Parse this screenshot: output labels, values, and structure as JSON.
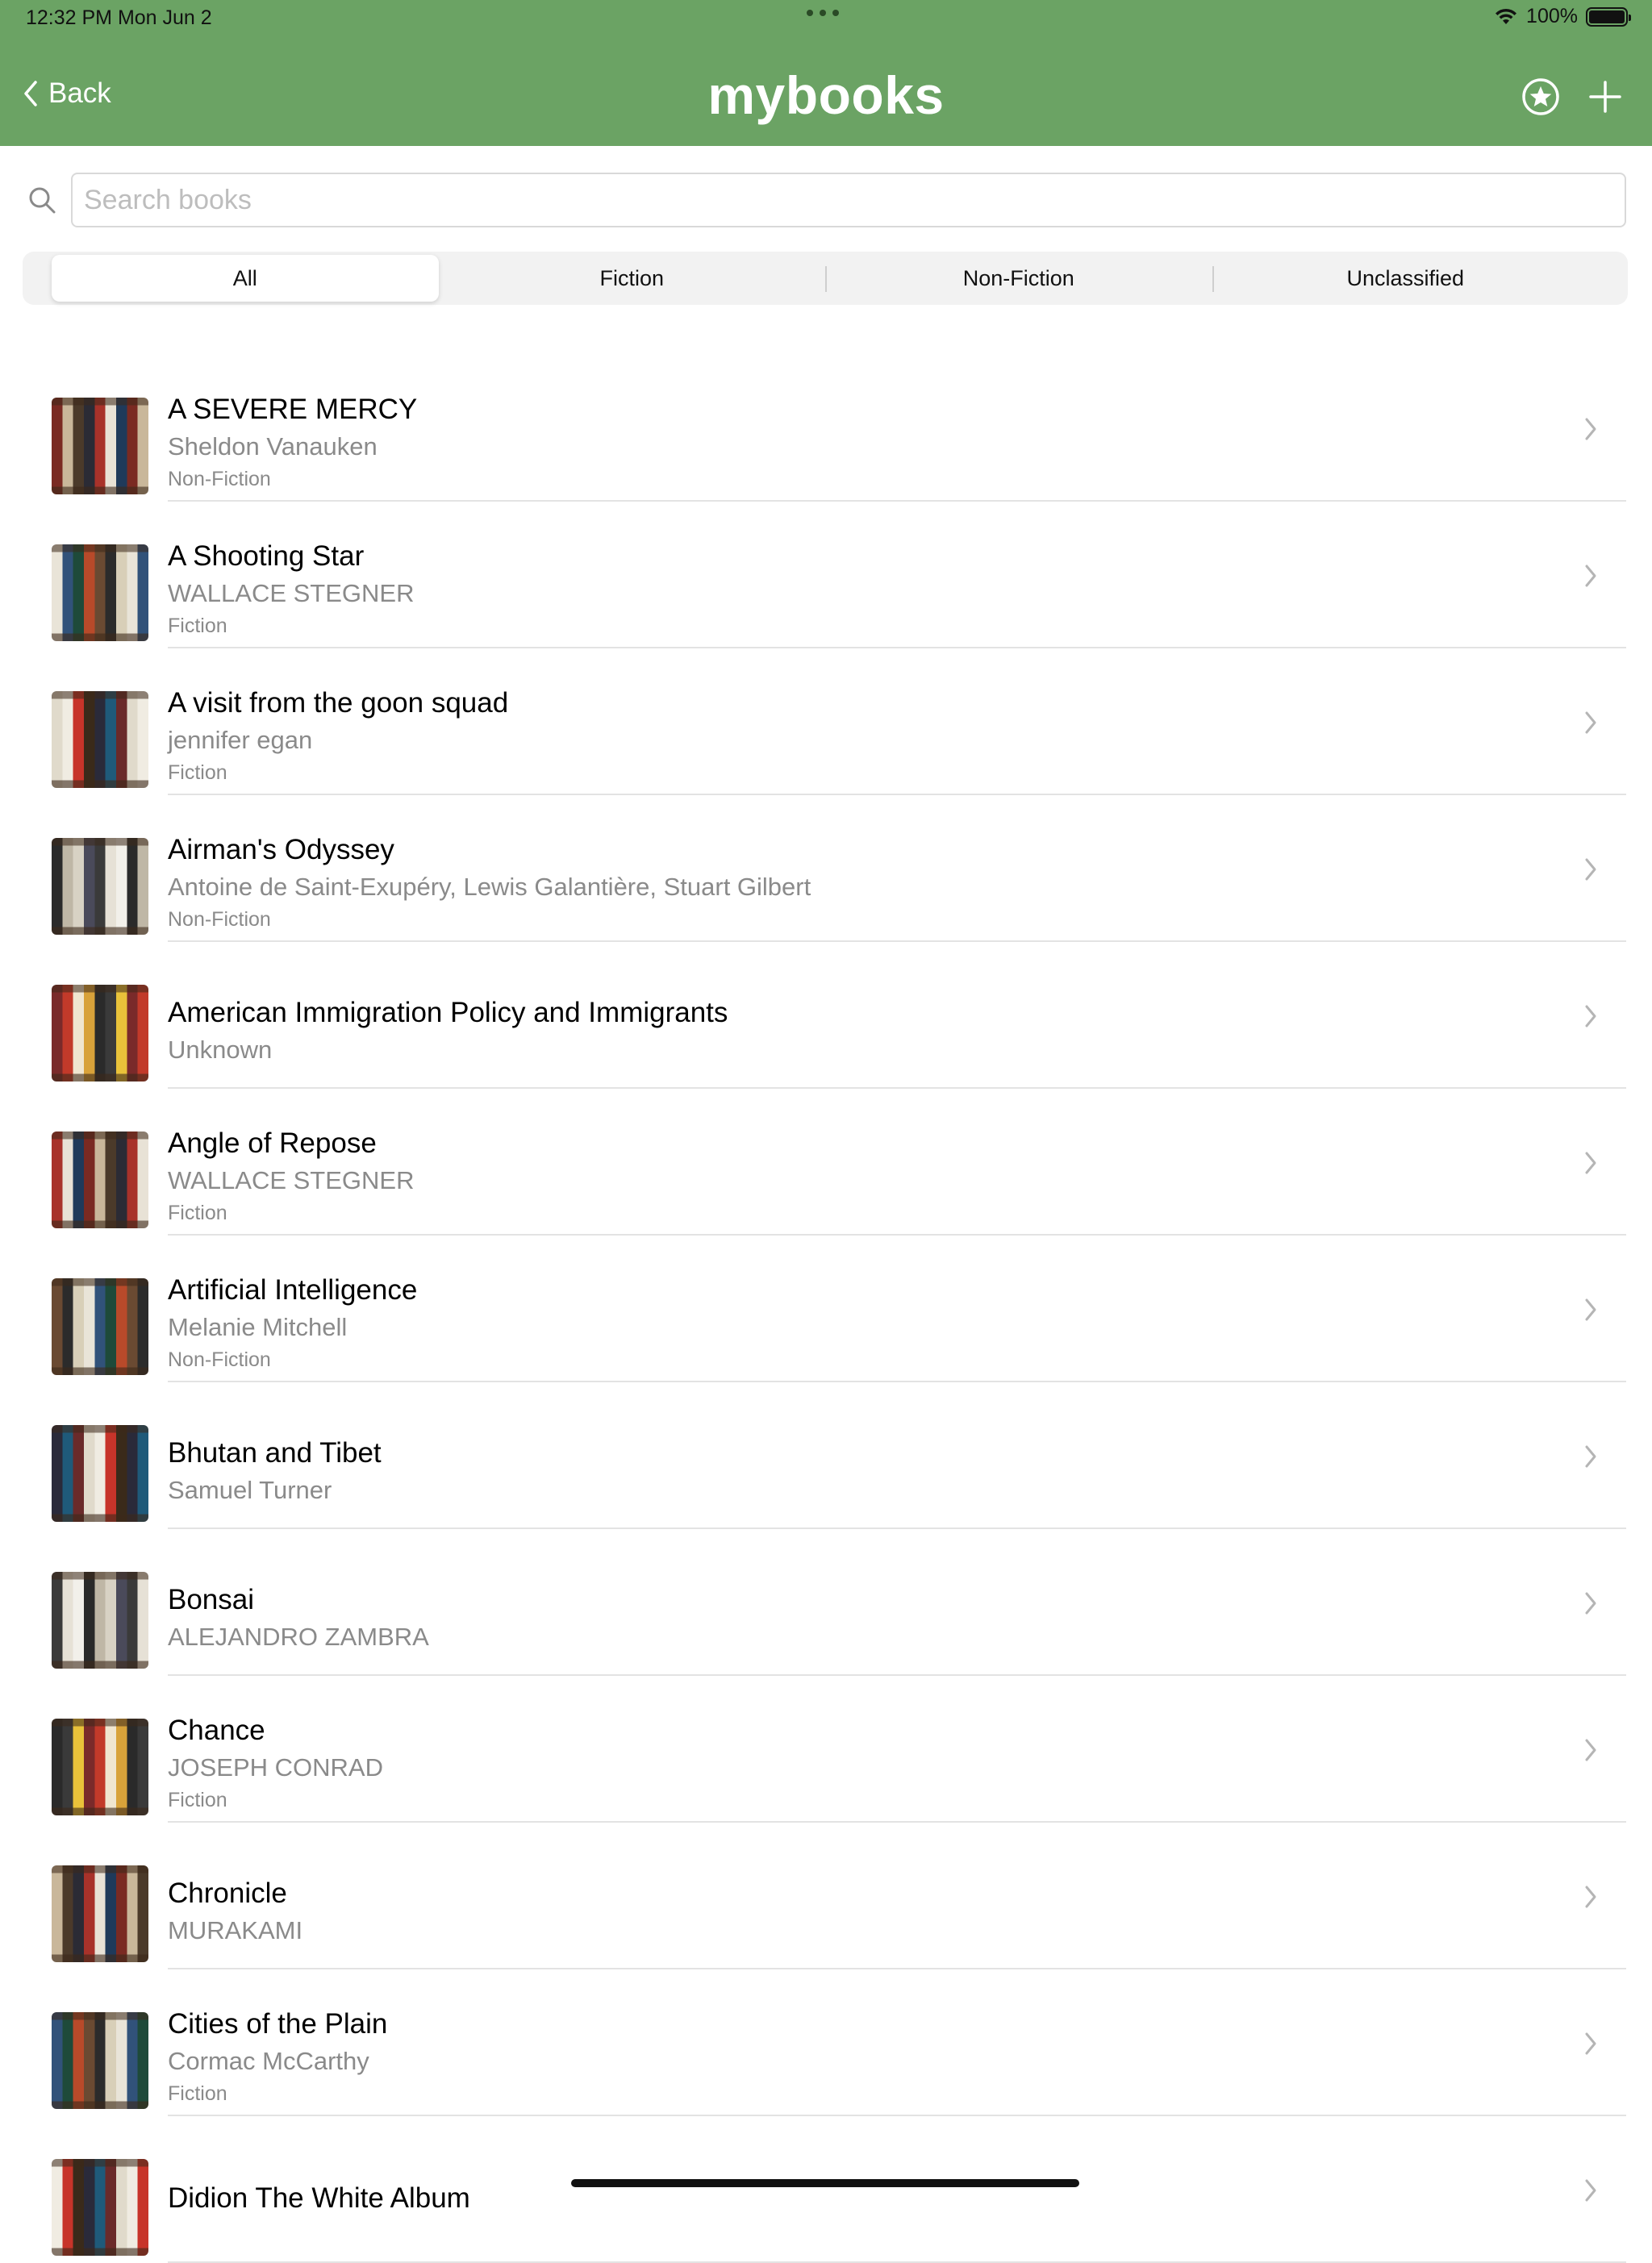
{
  "status": {
    "time": "12:32 PM   Mon Jun 2",
    "battery": "100%"
  },
  "header": {
    "back_label": "Back",
    "title": "mybooks"
  },
  "search": {
    "placeholder": "Search books"
  },
  "segments": [
    "All",
    "Fiction",
    "Non-Fiction",
    "Unclassified"
  ],
  "active_segment": "All",
  "books": [
    {
      "title": "A SEVERE MERCY",
      "author": "Sheldon Vanauken",
      "genre": "Non-Fiction"
    },
    {
      "title": "A Shooting Star",
      "author": "WALLACE STEGNER",
      "genre": "Fiction"
    },
    {
      "title": "A visit from the goon squad",
      "author": "jennifer egan",
      "genre": "Fiction"
    },
    {
      "title": "Airman's Odyssey",
      "author": "Antoine de Saint-Exupéry, Lewis Galantière, Stuart Gilbert",
      "genre": "Non-Fiction"
    },
    {
      "title": "American Immigration Policy and Immigrants",
      "author": "Unknown",
      "genre": ""
    },
    {
      "title": "Angle of Repose",
      "author": "WALLACE STEGNER",
      "genre": "Fiction"
    },
    {
      "title": "Artificial Intelligence",
      "author": "Melanie Mitchell",
      "genre": "Non-Fiction"
    },
    {
      "title": "Bhutan and Tibet",
      "author": "Samuel Turner",
      "genre": ""
    },
    {
      "title": "Bonsai",
      "author": "ALEJANDRO ZAMBRA",
      "genre": ""
    },
    {
      "title": "Chance",
      "author": "JOSEPH CONRAD",
      "genre": "Fiction"
    },
    {
      "title": "Chronicle",
      "author": "MURAKAMI",
      "genre": ""
    },
    {
      "title": "Cities of the Plain",
      "author": "Cormac McCarthy",
      "genre": "Fiction"
    },
    {
      "title": "Didion The White Album",
      "author": "",
      "genre": ""
    }
  ],
  "colors": {
    "header_bg": "#6ba364",
    "secondary_text": "#8a8a8a"
  }
}
